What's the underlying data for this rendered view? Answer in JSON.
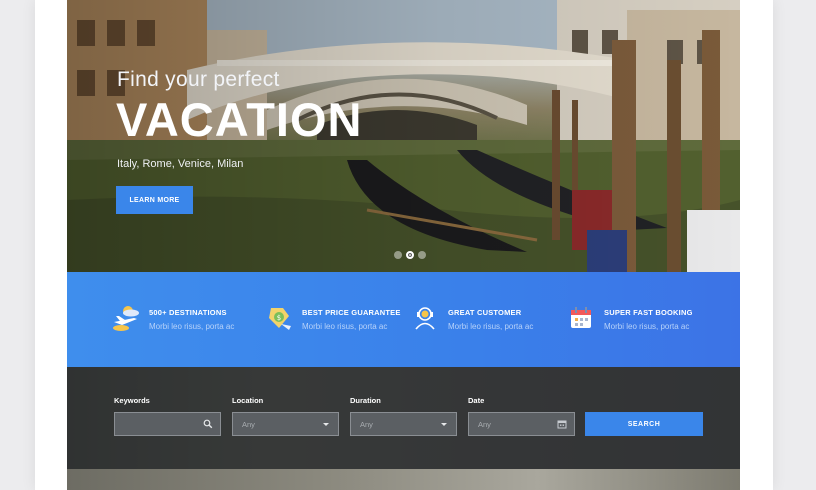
{
  "hero": {
    "subtitle": "Find your perfect",
    "title": "VACATION",
    "places": "Italy, Rome, Venice, Milan",
    "cta_label": "LEARN MORE",
    "slides_count": 3,
    "active_slide": 2
  },
  "features": [
    {
      "icon": "plane-clouds-icon",
      "title": "500+ DESTINATIONS",
      "desc": "Morbi leo risus, porta ac"
    },
    {
      "icon": "money-tag-icon",
      "title": "BEST PRICE GUARANTEE",
      "desc": "Morbi leo risus, porta ac"
    },
    {
      "icon": "customer-support-icon",
      "title": "GREAT CUSTOMER",
      "desc": "Morbi leo risus, porta ac"
    },
    {
      "icon": "calendar-icon",
      "title": "SUPER FAST BOOKING",
      "desc": "Morbi leo risus, porta ac"
    }
  ],
  "search": {
    "keywords_label": "Keywords",
    "keywords_value": "",
    "location_label": "Location",
    "location_value": "Any",
    "duration_label": "Duration",
    "duration_value": "Any",
    "date_label": "Date",
    "date_value": "Any",
    "button_label": "SEARCH"
  },
  "colors": {
    "accent": "#3a86ea",
    "feature_bar": "#3c80ea",
    "search_bar": "#45484a"
  }
}
